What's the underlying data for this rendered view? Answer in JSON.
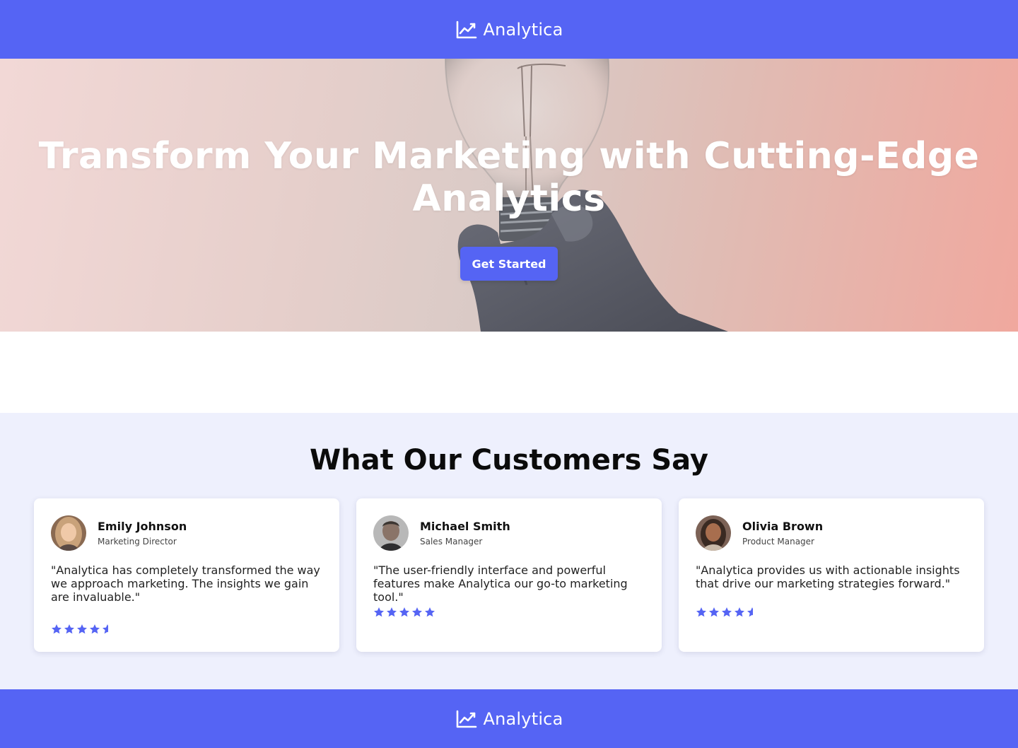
{
  "header": {
    "brand": "Analytica",
    "logo_icon": "line-chart-icon"
  },
  "hero": {
    "title": "Transform Your Marketing with Cutting-Edge Analytics",
    "cta_label": "Get Started",
    "background_image": "hand-holding-lightbulb-photo"
  },
  "testimonials": {
    "title": "What Our Customers Say",
    "items": [
      {
        "name": "Emily Johnson",
        "role": "Marketing Director",
        "quote": "\"Analytica has completely transformed the way we approach marketing. The insights we gain are invaluable.\"",
        "rating": 4.5
      },
      {
        "name": "Michael Smith",
        "role": "Sales Manager",
        "quote": "\"The user-friendly interface and powerful features make Analytica our go-to marketing tool.\"",
        "rating": 5
      },
      {
        "name": "Olivia Brown",
        "role": "Product Manager",
        "quote": "\"Analytica provides us with actionable insights that drive our marketing strategies forward.\"",
        "rating": 4.5
      }
    ]
  },
  "footer": {
    "brand": "Analytica",
    "logo_icon": "line-chart-icon"
  },
  "colors": {
    "brand": "#5564f4",
    "star": "#5564f4",
    "section_bg": "#eef0fd",
    "text": "#111111"
  }
}
